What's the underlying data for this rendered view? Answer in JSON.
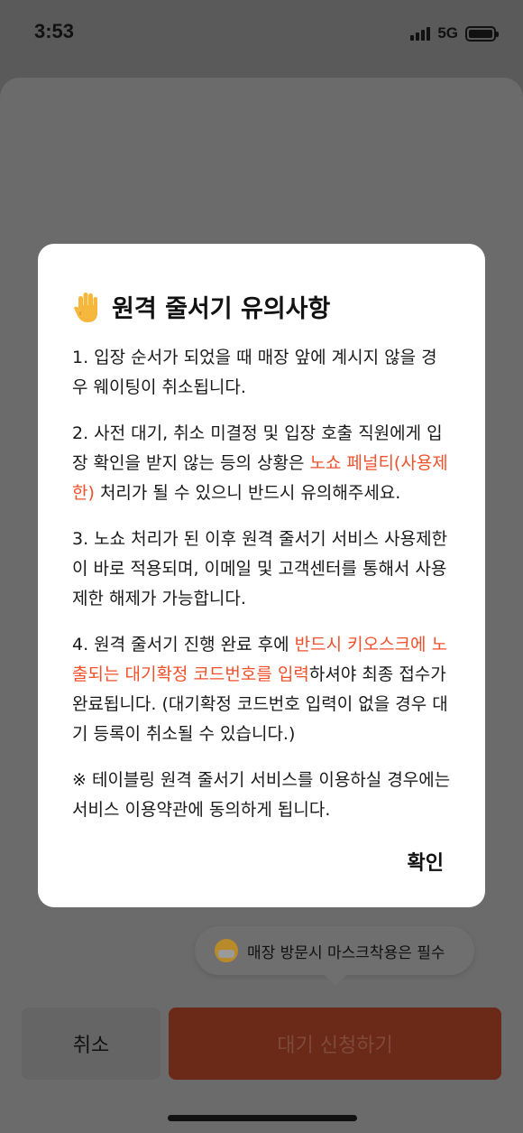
{
  "status_bar": {
    "time": "3:53",
    "network": "5G"
  },
  "tooltip": {
    "icon": "mask-face-icon",
    "text": "매장 방문시 마스크착용은 필수"
  },
  "buttons": {
    "cancel": "취소",
    "apply": "대기 신청하기"
  },
  "modal": {
    "title_icon": "raised-hand-icon",
    "title": "원격 줄서기 유의사항",
    "notice1": "1. 입장 순서가 되었을 때 매장 앞에 계시지 않을 경우 웨이팅이 취소됩니다.",
    "notice2": {
      "before": "2. 사전 대기, 취소 미결정 및 입장 호출 직원에게 입장 확인을 받지 않는 등의 상황은 ",
      "highlight": "노쇼 페널티(사용제한)",
      "after": " 처리가 될 수 있으니 반드시 유의해주세요."
    },
    "notice3": "3. 노쇼 처리가 된 이후 원격 줄서기 서비스 사용제한이 바로 적용되며, 이메일 및 고객센터를 통해서 사용제한 해제가 가능합니다.",
    "notice4": {
      "before": "4. 원격 줄서기 진행 완료 후에 ",
      "highlight": "반드시 키오스크에 노출되는 대기확정 코드번호를 입력",
      "after": "하셔야 최종 접수가 완료됩니다. (대기확정 코드번호 입력이 없을 경우 대기 등록이 취소될 수 있습니다.)"
    },
    "notice5": "※ 테이블링 원격 줄서기 서비스를 이용하실 경우에는 서비스 이용약관에 동의하게 됩니다.",
    "confirm": "확인"
  },
  "colors": {
    "highlight": "#f0512b",
    "apply_button": "#6b2a18",
    "overlay": "#5a5a5a"
  }
}
